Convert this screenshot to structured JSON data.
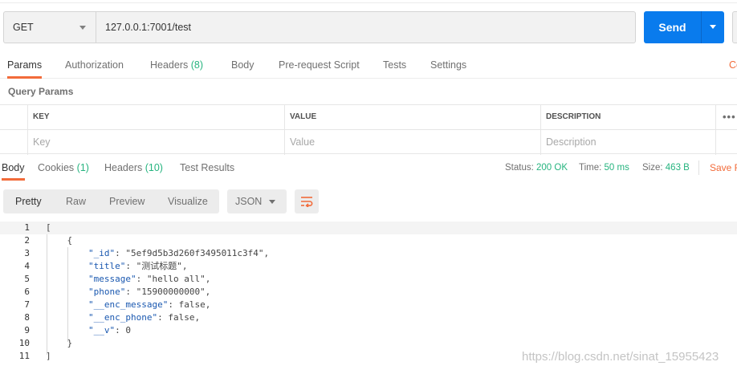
{
  "request": {
    "method": "GET",
    "url": "127.0.0.1:7001/test",
    "send_label": "Send"
  },
  "request_tabs": [
    {
      "label": "Params",
      "count": ""
    },
    {
      "label": "Authorization",
      "count": ""
    },
    {
      "label": "Headers",
      "count": "(8)"
    },
    {
      "label": "Body",
      "count": ""
    },
    {
      "label": "Pre-request Script",
      "count": ""
    },
    {
      "label": "Tests",
      "count": ""
    },
    {
      "label": "Settings",
      "count": ""
    }
  ],
  "request_tabs_cut_label": "Co",
  "query_params": {
    "title": "Query Params",
    "headers": [
      "KEY",
      "VALUE",
      "DESCRIPTION"
    ],
    "placeholders": [
      "Key",
      "Value",
      "Description"
    ],
    "more": "•••"
  },
  "response_tabs": [
    {
      "label": "Body",
      "count": ""
    },
    {
      "label": "Cookies",
      "count": "(1)"
    },
    {
      "label": "Headers",
      "count": "(10)"
    },
    {
      "label": "Test Results",
      "count": ""
    }
  ],
  "response_meta": {
    "status_label": "Status:",
    "status_value": "200 OK",
    "time_label": "Time:",
    "time_value": "50 ms",
    "size_label": "Size:",
    "size_value": "463 B",
    "save_label": "Save R"
  },
  "view_modes": [
    "Pretty",
    "Raw",
    "Preview",
    "Visualize"
  ],
  "format": "JSON",
  "code_lines": [
    {
      "n": "1",
      "t": "["
    },
    {
      "n": "2",
      "t": "    {"
    },
    {
      "n": "3",
      "t": "        \"_id\": \"5ef9d5b3d260f3495011c3f4\","
    },
    {
      "n": "4",
      "t": "        \"title\": \"测试标题\","
    },
    {
      "n": "5",
      "t": "        \"message\": \"hello all\","
    },
    {
      "n": "6",
      "t": "        \"phone\": \"15900000000\","
    },
    {
      "n": "7",
      "t": "        \"__enc_message\": false,"
    },
    {
      "n": "8",
      "t": "        \"__enc_phone\": false,"
    },
    {
      "n": "9",
      "t": "        \"__v\": 0"
    },
    {
      "n": "10",
      "t": "    }"
    },
    {
      "n": "11",
      "t": "]"
    }
  ],
  "watermark": "https://blog.csdn.net/sinat_15955423",
  "colors": {
    "accent": "#f26b3a",
    "send": "#097bed",
    "ok": "#26b47f"
  }
}
